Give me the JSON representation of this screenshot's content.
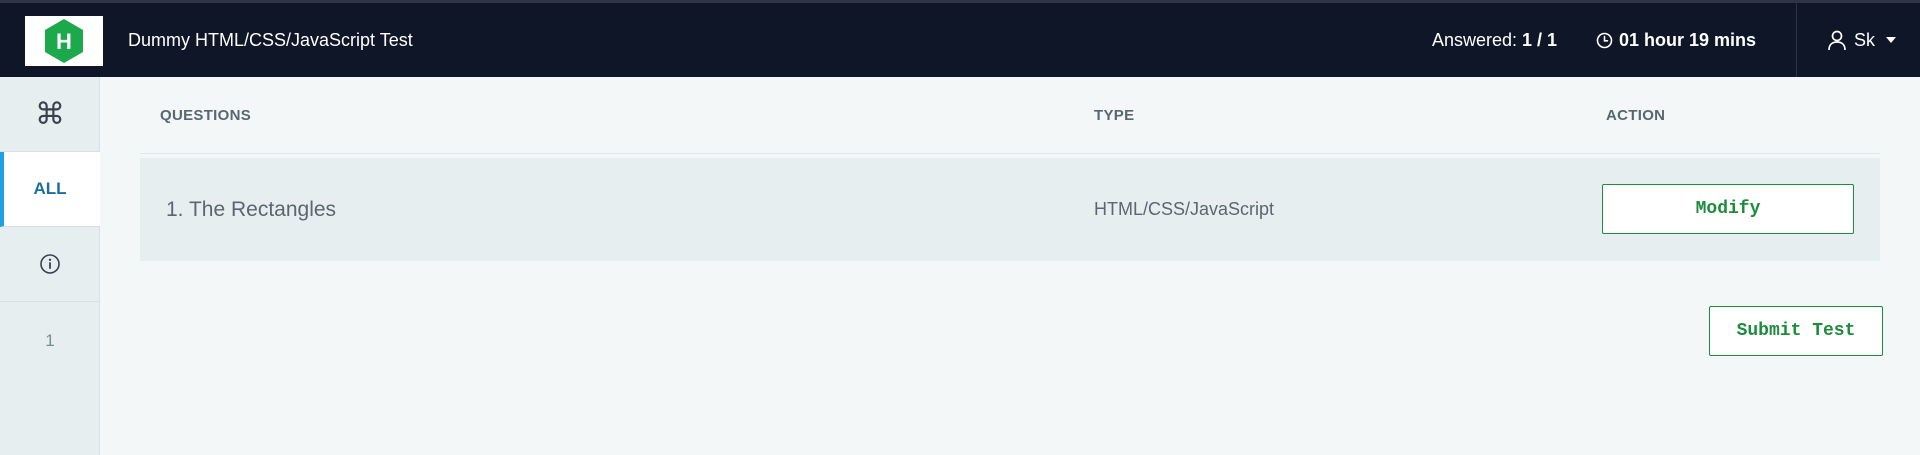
{
  "header": {
    "logo_letter": "H",
    "test_title": "Dummy HTML/CSS/JavaScript Test",
    "answered_label": "Answered:",
    "answered_value": "1 / 1",
    "time_remaining": "01 hour 19 mins",
    "user_name": "Sk",
    "icons": {
      "logo": "hackerrank-logo",
      "clock": "clock-icon",
      "user": "user-icon",
      "dropdown": "caret-down-icon"
    },
    "colors": {
      "bar": "#0e1628",
      "logo_green": "#1ba94c"
    }
  },
  "rail": {
    "command_glyph": "⌘",
    "all_label": "ALL",
    "info_icon": "info-icon",
    "question_number": "1"
  },
  "table": {
    "columns": [
      "QUESTIONS",
      "TYPE",
      "ACTION"
    ],
    "rows": [
      {
        "title": "1. The Rectangles",
        "type": "HTML/CSS/JavaScript",
        "action": "Modify"
      }
    ]
  },
  "actions": {
    "submit_label": "Submit Test",
    "accent": "#1d8c3b"
  }
}
